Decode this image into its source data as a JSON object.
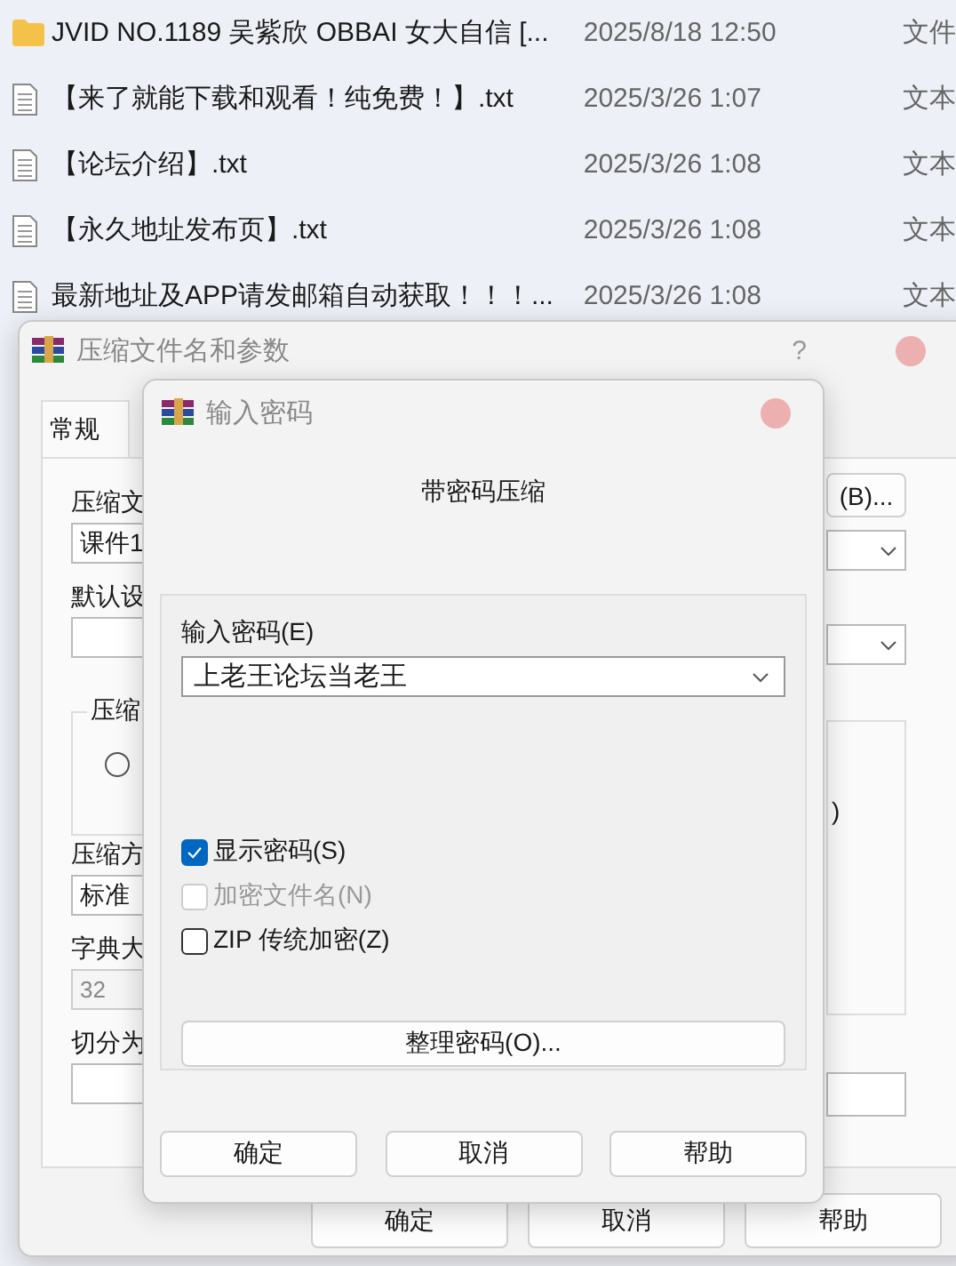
{
  "file_list": {
    "rows": [
      {
        "kind": "folder",
        "name": "JVID NO.1189 吴紫欣 OBBAI 女大自信 [...",
        "date": "2025/8/18 12:50",
        "type": "文件"
      },
      {
        "kind": "text",
        "name": "【来了就能下载和观看！纯免费！】.txt",
        "date": "2025/3/26 1:07",
        "type": "文本"
      },
      {
        "kind": "text",
        "name": "【论坛介绍】.txt",
        "date": "2025/3/26 1:08",
        "type": "文本"
      },
      {
        "kind": "text",
        "name": "【永久地址发布页】.txt",
        "date": "2025/3/26 1:08",
        "type": "文本"
      },
      {
        "kind": "text",
        "name": "最新地址及APP请发邮箱自动获取！！！...",
        "date": "2025/3/26 1:08",
        "type": "文本"
      }
    ]
  },
  "archive_dialog": {
    "title": "压缩文件名和参数",
    "help": "?",
    "tabs": [
      {
        "label": "常规",
        "selected": true
      }
    ],
    "archive_name_label": "压缩文",
    "archive_name_value": "课件1",
    "browse_button": "(B)...",
    "profile_label": "默认设",
    "group_label": "压缩",
    "radio": {
      "selected": false
    },
    "group_fragment": ")",
    "method_label": "压缩方",
    "method_value": "标准",
    "dict_label": "字典大",
    "dict_value": "32",
    "dict_disabled": true,
    "split_label": "切分为",
    "buttons": [
      "确定",
      "取消",
      "帮助"
    ]
  },
  "password_dialog": {
    "title": "输入密码",
    "heading": "带密码压缩",
    "password_label": "输入密码(E)",
    "password_value": "上老王论坛当老王",
    "options": [
      {
        "label": "显示密码(S)",
        "checked": true,
        "disabled": false
      },
      {
        "label": "加密文件名(N)",
        "checked": false,
        "disabled": true
      },
      {
        "label": "ZIP 传统加密(Z)",
        "checked": false,
        "disabled": false
      }
    ],
    "organize_button": "整理密码(O)...",
    "buttons": [
      "确定",
      "取消",
      "帮助"
    ]
  }
}
